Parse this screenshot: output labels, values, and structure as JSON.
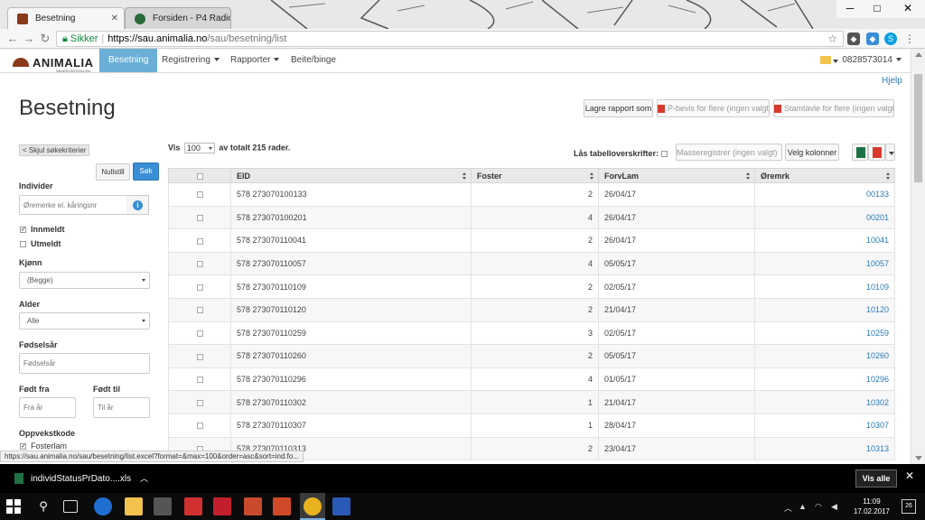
{
  "browser": {
    "tabs": [
      {
        "label": "Besetning",
        "active": true
      },
      {
        "label": "Forsiden - P4 Radio Hele",
        "active": false
      }
    ],
    "secure_label": "Sikker",
    "url_host": "https://sau.animalia.no",
    "url_path": "/sau/besetning/list",
    "status_url": "https://sau.animalia.no/sau/besetning/list.excel?format=&max=100&order=asc&sort=ind.fo..."
  },
  "nav": {
    "logo_text": "ANIMALIA",
    "logo_sub": "SAUEKONTROLLEN",
    "items": [
      "Besetning",
      "Registrering",
      "Rapporter",
      "Beite/binge"
    ],
    "user": "0828573014"
  },
  "page": {
    "help": "Hjelp",
    "title": "Besetning",
    "buttons": {
      "save_report": "Lagre rapport som",
      "pbevis": "P-bevis for flere (ingen valgt)",
      "stamtavle": "Stamtavle for flere (ingen valgt)"
    }
  },
  "filters": {
    "toggle": "< Skjul søkekriterier",
    "reset": "Nullstill",
    "search": "Søk",
    "individer_label": "Individer",
    "individer_placeholder": "Øremerke el. kåringsnr",
    "innmeldt": "Innmeldt",
    "utmeldt": "Utmeldt",
    "kjonn_label": "Kjønn",
    "kjonn_value": "(Begge)",
    "alder_label": "Alder",
    "alder_value": "Alle",
    "fodselsar_label": "Fødselsår",
    "fodselsar_placeholder": "Fødselsår",
    "fodt_fra_label": "Født fra",
    "fodt_fra_placeholder": "Fra år",
    "fodt_til_label": "Født til",
    "fodt_til_placeholder": "Til år",
    "oppvekstkode_label": "Oppvekstkode",
    "fosterlam": "Fosterlam"
  },
  "table_controls": {
    "vis": "Vis",
    "page_size": "100",
    "total_text": "av totalt 215 rader.",
    "lock_headers": "Lås tabelloverskrifter:",
    "masse": "Masseregistrer (ingen valgt)",
    "velg_kolonner": "Velg kolonner"
  },
  "table": {
    "headers": [
      "EID",
      "Foster",
      "ForvLam",
      "Øremrk"
    ],
    "rows": [
      {
        "eid": "578 273070100133",
        "foster": "2",
        "forvlam": "26/04/17",
        "oremrk": "00133"
      },
      {
        "eid": "578 273070100201",
        "foster": "4",
        "forvlam": "26/04/17",
        "oremrk": "00201"
      },
      {
        "eid": "578 273070110041",
        "foster": "2",
        "forvlam": "26/04/17",
        "oremrk": "10041"
      },
      {
        "eid": "578 273070110057",
        "foster": "4",
        "forvlam": "05/05/17",
        "oremrk": "10057"
      },
      {
        "eid": "578 273070110109",
        "foster": "2",
        "forvlam": "02/05/17",
        "oremrk": "10109"
      },
      {
        "eid": "578 273070110120",
        "foster": "2",
        "forvlam": "21/04/17",
        "oremrk": "10120"
      },
      {
        "eid": "578 273070110259",
        "foster": "3",
        "forvlam": "02/05/17",
        "oremrk": "10259"
      },
      {
        "eid": "578 273070110260",
        "foster": "2",
        "forvlam": "05/05/17",
        "oremrk": "10260"
      },
      {
        "eid": "578 273070110296",
        "foster": "4",
        "forvlam": "01/05/17",
        "oremrk": "10296"
      },
      {
        "eid": "578 273070110302",
        "foster": "1",
        "forvlam": "21/04/17",
        "oremrk": "10302"
      },
      {
        "eid": "578 273070110307",
        "foster": "1",
        "forvlam": "28/04/17",
        "oremrk": "10307"
      },
      {
        "eid": "578 273070110313",
        "foster": "2",
        "forvlam": "23/04/17",
        "oremrk": "10313"
      }
    ]
  },
  "download": {
    "file": "individStatusPrDato....xls",
    "show_all": "Vis alle"
  },
  "taskbar": {
    "time": "11:09",
    "date": "17.02.2017",
    "notifications": "26"
  },
  "colors": {
    "accent": "#6ab0d6",
    "link": "#2a7ab8",
    "primary_button": "#3a8ed6"
  }
}
